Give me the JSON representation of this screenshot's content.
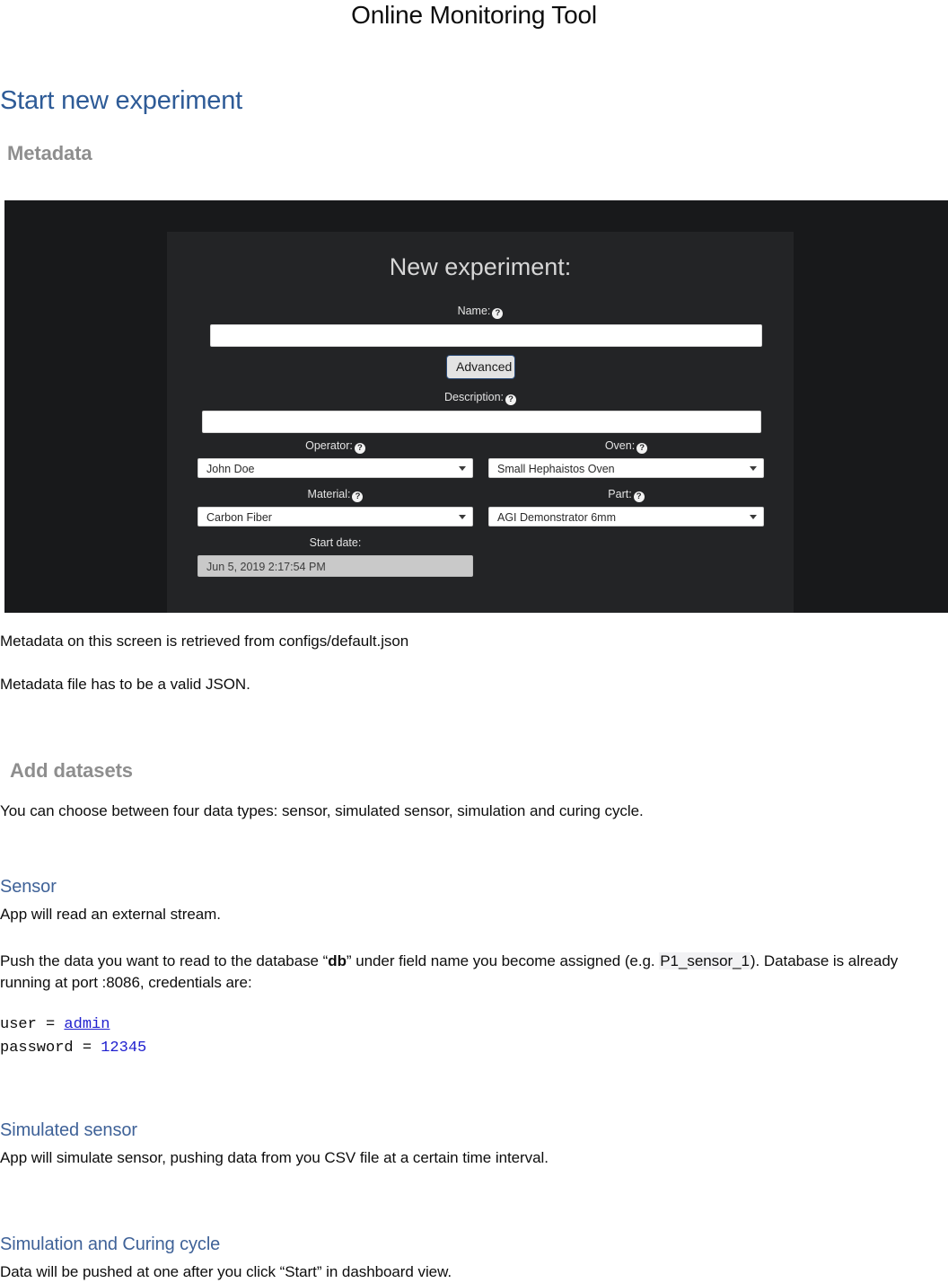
{
  "document": {
    "title": "Online Monitoring Tool",
    "section_start": "Start new experiment",
    "heading_metadata": "Metadata",
    "heading_add_datasets": "Add datasets",
    "para_metadata_source": "Metadata on this screen is retrieved from configs/default.json",
    "para_metadata_json": "Metadata file has to be a valid JSON.",
    "para_four_types": "You can choose between four data types: sensor, simulated sensor, simulation and curing cycle.",
    "heading_sensor": "Sensor",
    "para_sensor_stream": "App will read an external stream.",
    "push_part1": "Push the data you want to read to the database “",
    "push_db": "db",
    "push_part2": "” under field name you become assigned (e.g. ",
    "push_field_example": "P1_sensor_1",
    "push_part3": ").",
    "push_part4": "Database is already running at port :8086, credentials are:",
    "code_user_label": "user = ",
    "code_user_value": "admin",
    "code_password_label": "password = ",
    "code_password_value": "12345",
    "heading_simulated_sensor": "Simulated sensor",
    "para_simulated_sensor": "App will simulate sensor, pushing data from you CSV file at a certain time interval.",
    "heading_simulation_curing": "Simulation and Curing cycle",
    "para_simulation_curing": "Data will be pushed at one after you click “Start” in dashboard view."
  },
  "screenshot": {
    "title": "New experiment:",
    "help_glyph": "?",
    "name": {
      "label": "Name:",
      "value": "",
      "placeholder": ""
    },
    "advanced_button": "Advanced",
    "description": {
      "label": "Description:",
      "value": "",
      "placeholder": ""
    },
    "operator": {
      "label": "Operator:",
      "value": "John Doe"
    },
    "oven": {
      "label": "Oven:",
      "value": "Small Hephaistos Oven"
    },
    "material": {
      "label": "Material:",
      "value": "Carbon Fiber"
    },
    "part": {
      "label": "Part:",
      "value": "AGI Demonstrator 6mm"
    },
    "start_date": {
      "label": "Start date:",
      "value": "Jun 5, 2019 2:17:54 PM"
    }
  },
  "colors": {
    "heading_blue": "#2e5b97",
    "subheading_blue": "#3f6298",
    "heading_gray": "#8e8e8e",
    "code_link_blue": "#2020cf",
    "shot_background": "#18191b",
    "shot_panel": "#232426",
    "advanced_border": "#2a4a76"
  }
}
